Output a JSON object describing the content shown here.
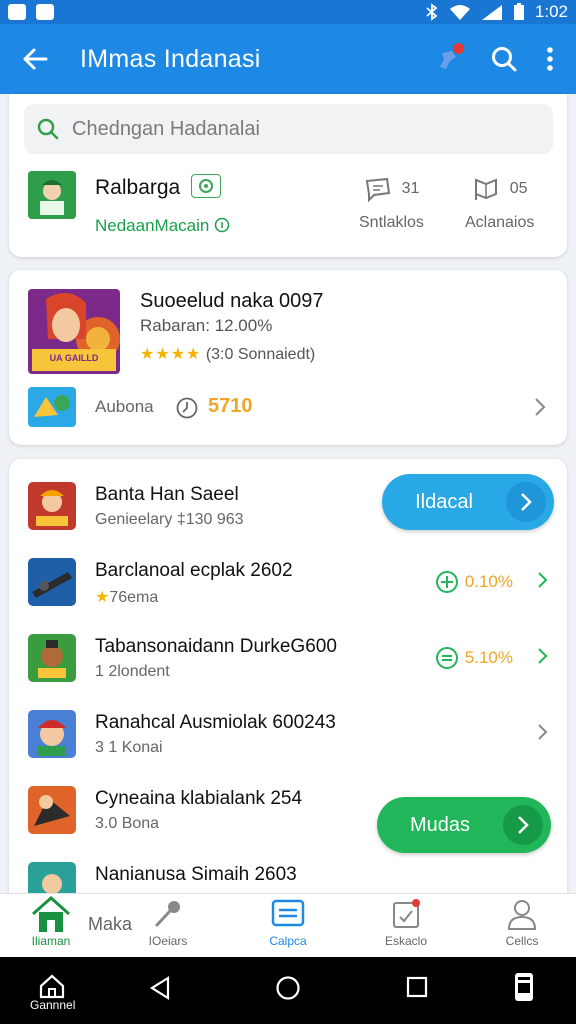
{
  "status_bar": {
    "time": "1:02"
  },
  "app_bar": {
    "title": "IMmas Indanasi"
  },
  "search": {
    "placeholder": "Chedngan Hadanalai"
  },
  "profile": {
    "name": "Ralbarga",
    "subtitle": "NedaanMacain",
    "stats": [
      {
        "value": "31",
        "label": "Sntlaklos"
      },
      {
        "value": "05",
        "label": "Aclanaios"
      }
    ]
  },
  "featured": {
    "title": "Suoeelud naka 0097",
    "subtitle": "Rabaran: 12.00%",
    "rating_stars": "★★★★",
    "rating_text": "(3:0 Sonnaiedt)",
    "thumb_text": "UA GAILLD",
    "meta_label": "Aubona",
    "score": "5710"
  },
  "list": [
    {
      "name": "Banta Han Saeel",
      "sub": "Genieelary ‡130 963"
    },
    {
      "name": "Barclanoal ecplak 2602",
      "sub_star": "★",
      "sub": "76ema",
      "metric": "0.10%"
    },
    {
      "name": "Tabansonaidann DurkeG600",
      "sub": "1 2londent",
      "metric": "5.10%"
    },
    {
      "name": "Ranahcal Ausmiolak 600243",
      "sub": "3 1 Konai"
    },
    {
      "name": "Cyneaina klabialank 254",
      "sub": "3.0 Bona"
    },
    {
      "name": "Nanianusa Simaih 2603",
      "sub": ""
    }
  ],
  "buttons": {
    "primary": "Ildacal",
    "secondary": "Mudas"
  },
  "bottom_nav": {
    "home": "Iliaman",
    "maka": "Maka",
    "item2": "IOeiars",
    "item3": "Calpca",
    "item4": "Eskaclo",
    "item5": "Cellcs"
  },
  "system_nav": {
    "home_label": "Gannnel"
  },
  "colors": {
    "app_bar": "#1e88e5",
    "accent_green": "#21b65a",
    "accent_blue": "#29a8e6",
    "score_orange": "#f0a626"
  }
}
